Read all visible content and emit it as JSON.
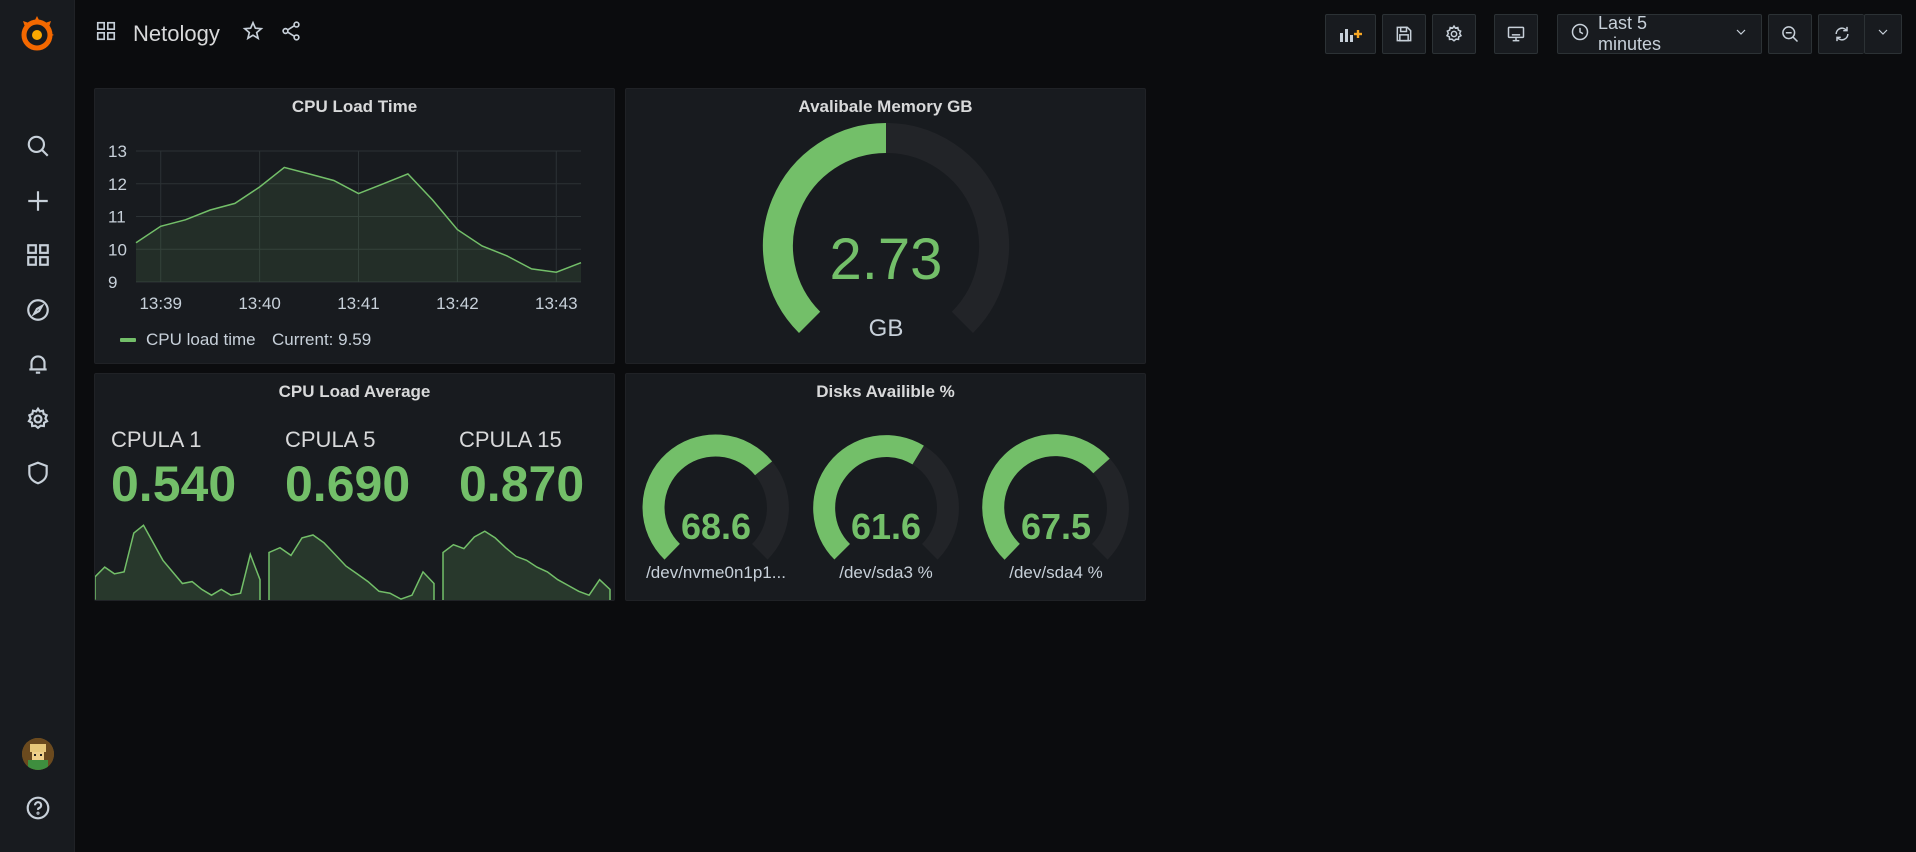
{
  "dashboard": {
    "title": "Netology"
  },
  "toolbar": {
    "time_range": "Last 5 minutes"
  },
  "colors": {
    "accent": "#73bf69",
    "panel_bg": "#181b1f",
    "page_bg": "#0b0c0e",
    "track": "#222428"
  },
  "sidebar": {
    "items": [
      {
        "icon": "search-icon"
      },
      {
        "icon": "plus-icon"
      },
      {
        "icon": "dashboards-icon"
      },
      {
        "icon": "compass-icon"
      },
      {
        "icon": "bell-icon"
      },
      {
        "icon": "gear-icon"
      },
      {
        "icon": "shield-icon"
      },
      {
        "icon": "avatar"
      },
      {
        "icon": "help-icon"
      }
    ]
  },
  "panels": {
    "cpu_time": {
      "title": "CPU Load Time",
      "legend_label": "CPU load time",
      "legend_current": "Current: 9.59",
      "chart_data": {
        "type": "area",
        "x": [
          "13:38:45",
          "13:39:00",
          "13:39:15",
          "13:39:30",
          "13:39:45",
          "13:40:00",
          "13:40:15",
          "13:40:30",
          "13:40:45",
          "13:41:00",
          "13:41:15",
          "13:41:30",
          "13:41:45",
          "13:42:00",
          "13:42:15",
          "13:42:30",
          "13:42:45",
          "13:43:00",
          "13:43:15"
        ],
        "values": [
          10.2,
          10.7,
          10.9,
          11.2,
          11.4,
          11.9,
          12.5,
          12.3,
          12.1,
          11.7,
          12.0,
          12.3,
          11.5,
          10.6,
          10.1,
          9.8,
          9.4,
          9.3,
          9.59
        ],
        "x_ticks": [
          "13:39",
          "13:40",
          "13:41",
          "13:42",
          "13:43"
        ],
        "y_ticks": [
          "9",
          "10",
          "11",
          "12",
          "13"
        ],
        "ylim": [
          9,
          13
        ],
        "grid": true,
        "legend": "bottom-left"
      }
    },
    "memory": {
      "title": "Avalibale Memory GB",
      "value": "2.73",
      "unit": "GB",
      "fraction": 0.5
    },
    "cpu_avg": {
      "title": "CPU Load Average",
      "stats": [
        {
          "label": "CPULA 1",
          "value": "0.540",
          "spark": [
            0.25,
            0.35,
            0.28,
            0.3,
            0.7,
            0.78,
            0.6,
            0.42,
            0.3,
            0.18,
            0.2,
            0.12,
            0.06,
            0.12,
            0.06,
            0.08,
            0.48,
            0.22
          ]
        },
        {
          "label": "CPULA 5",
          "value": "0.690",
          "spark": [
            0.5,
            0.55,
            0.47,
            0.65,
            0.68,
            0.6,
            0.48,
            0.36,
            0.28,
            0.2,
            0.1,
            0.08,
            0.02,
            0.06,
            0.3,
            0.18
          ]
        },
        {
          "label": "CPULA 15",
          "value": "0.870",
          "spark": [
            0.5,
            0.58,
            0.54,
            0.66,
            0.72,
            0.65,
            0.55,
            0.46,
            0.42,
            0.35,
            0.3,
            0.22,
            0.16,
            0.1,
            0.06,
            0.22,
            0.12
          ]
        }
      ]
    },
    "disks": {
      "title": "Disks Availible %",
      "gauges": [
        {
          "label": "/dev/nvme0n1p1...",
          "value": "68.6",
          "fraction": 0.686
        },
        {
          "label": "/dev/sda3 %",
          "value": "61.6",
          "fraction": 0.616
        },
        {
          "label": "/dev/sda4 %",
          "value": "67.5",
          "fraction": 0.675
        }
      ]
    }
  }
}
